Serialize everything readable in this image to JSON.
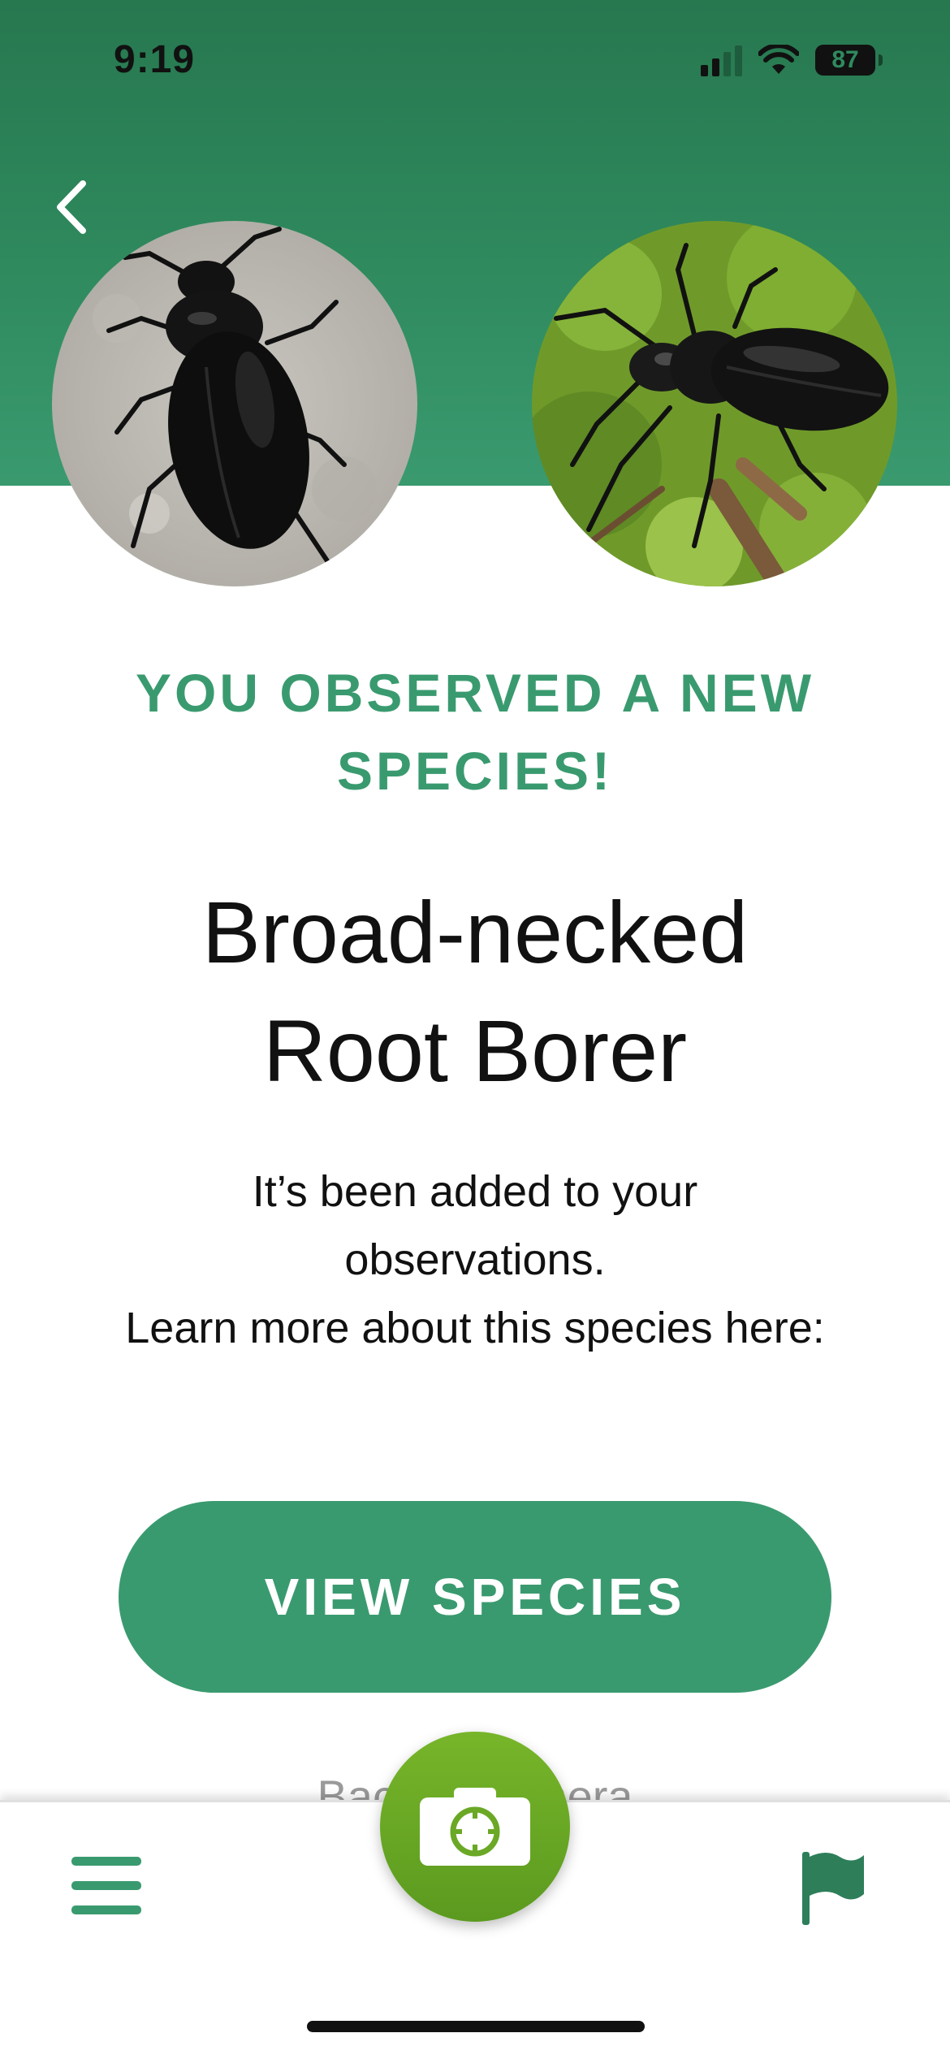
{
  "status_bar": {
    "time": "9:19",
    "battery": "87",
    "icons": [
      "signal-icon",
      "wifi-icon",
      "battery-icon"
    ]
  },
  "header": {
    "back_icon": "chevron-left-icon",
    "photos": [
      "user-observation-photo",
      "reference-species-photo"
    ]
  },
  "content": {
    "headline": "YOU OBSERVED A NEW SPECIES!",
    "species_name": "Broad-necked Root Borer",
    "message_line1": "It’s been added to your observations.",
    "message_line2": "Learn more about this species here:",
    "view_button": "VIEW SPECIES",
    "back_link": "Back to camera"
  },
  "bottom_nav": {
    "menu_icon": "hamburger-menu-icon",
    "camera_icon": "camera-icon",
    "flag_icon": "flag-icon"
  },
  "colors": {
    "brand_green": "#3a9a6f",
    "header_green": "#27774f",
    "camera_green": "#6aa825"
  }
}
